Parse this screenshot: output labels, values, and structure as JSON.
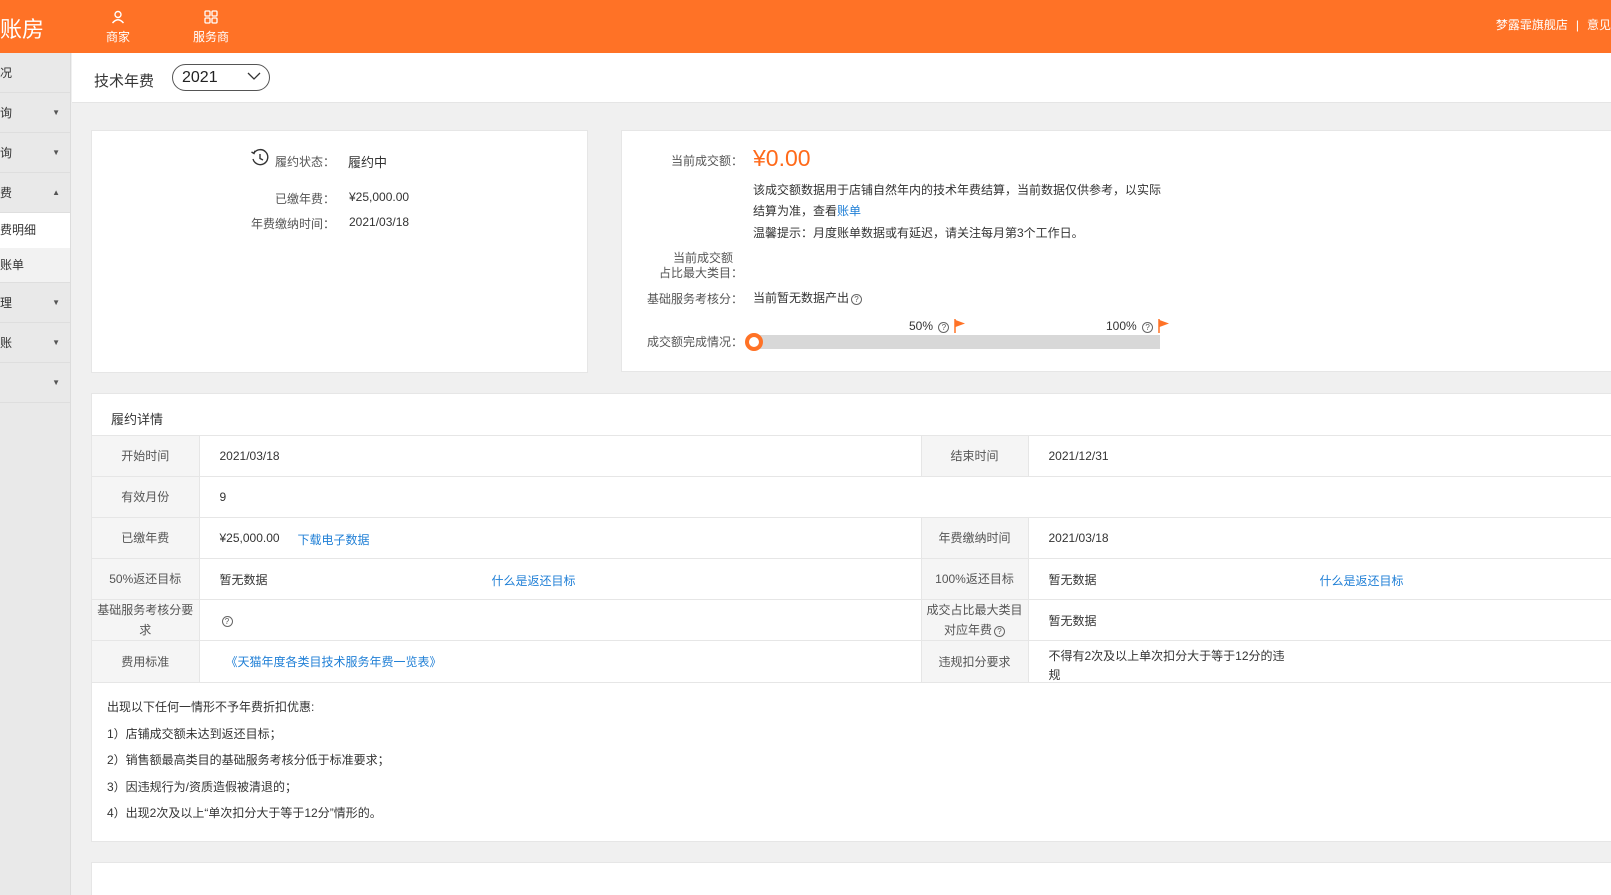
{
  "topbar": {
    "brand": "账房",
    "nav": [
      {
        "label": "商家",
        "icon": "user-icon"
      },
      {
        "label": "服务商",
        "icon": "grid-icon"
      }
    ],
    "store_name": "梦露霏旗舰店",
    "separator": "|",
    "feedback": "意见"
  },
  "sidebar": {
    "items": [
      {
        "label": "况",
        "caret": ""
      },
      {
        "label": "询",
        "caret": "▼"
      },
      {
        "label": "询",
        "caret": "▼"
      },
      {
        "label": "费",
        "caret": "▲"
      }
    ],
    "sub_items": [
      {
        "label": "费明细",
        "active": true
      },
      {
        "label": "账单",
        "active": false
      }
    ],
    "items_after": [
      {
        "label": "理",
        "caret": "▼"
      },
      {
        "label": "账",
        "caret": "▼"
      },
      {
        "label": "",
        "caret": "▼"
      }
    ]
  },
  "header": {
    "title": "技术年费",
    "year": "2021"
  },
  "status_card": {
    "status_label": "履约状态：",
    "status_value": "履约中",
    "paid_label": "已缴年费：",
    "paid_value": "¥25,000.00",
    "paid_time_label": "年费缴纳时间：",
    "paid_time_value": "2021/03/18"
  },
  "amount_card": {
    "amount_label": "当前成交额：",
    "amount_value": "¥0.00",
    "note_line1": "该成交额数据用于店铺自然年内的技术年费结算，当前数据仅供参考，以实际",
    "note_line2_prefix": "结算为准，查看",
    "note_line2_link": "账单",
    "tip": "温馨提示：月度账单数据或有延迟，请关注每月第3个工作日。",
    "ratio_label_line1": "当前成交额",
    "ratio_label_line2": "占比最大类目：",
    "score_label": "基础服务考核分：",
    "score_value": "当前暂无数据产出",
    "progress_label": "成交额完成情况：",
    "progress_value": 0,
    "mark_50": "50%",
    "mark_100": "100%"
  },
  "detail": {
    "title": "履约详情",
    "start_label": "开始时间",
    "start_value": "2021/03/18",
    "end_label": "结束时间",
    "end_value": "2021/12/31",
    "months_label": "有效月份",
    "months_value": "9",
    "paid_label": "已缴年费",
    "paid_value": "¥25,000.00",
    "download_link": "下载电子数据",
    "paid_time_label": "年费缴纳时间",
    "paid_time_value": "2021/03/18",
    "target50_label": "50%返还目标",
    "target50_value": "暂无数据",
    "target50_link": "什么是返还目标",
    "target100_label": "100%返还目标",
    "target100_value": "暂无数据",
    "target100_link": "什么是返还目标",
    "score_req_label": "基础服务考核分要求",
    "max_cat_label": "成交占比最大类目对应年费",
    "max_cat_value": "暂无数据",
    "fee_std_label": "费用标准",
    "fee_std_link": "《天猫年度各类目技术服务年费一览表》",
    "violation_label": "违规扣分要求",
    "violation_value": "不得有2次及以上单次扣分大于等于12分的违规"
  },
  "notes": {
    "intro": "出现以下任何一情形不予年费折扣优惠:",
    "items": [
      "1）店铺成交额未达到返还目标；",
      "2）销售额最高类目的基础服务考核分低于标准要求；",
      "3）因违规行为/资质造假被清退的；",
      "4）出现2次及以上“单次扣分大于等于12分”情形的。"
    ]
  },
  "colors": {
    "brand": "#ff7226",
    "amount": "#ff6a1a",
    "link": "#1f7fd6"
  }
}
